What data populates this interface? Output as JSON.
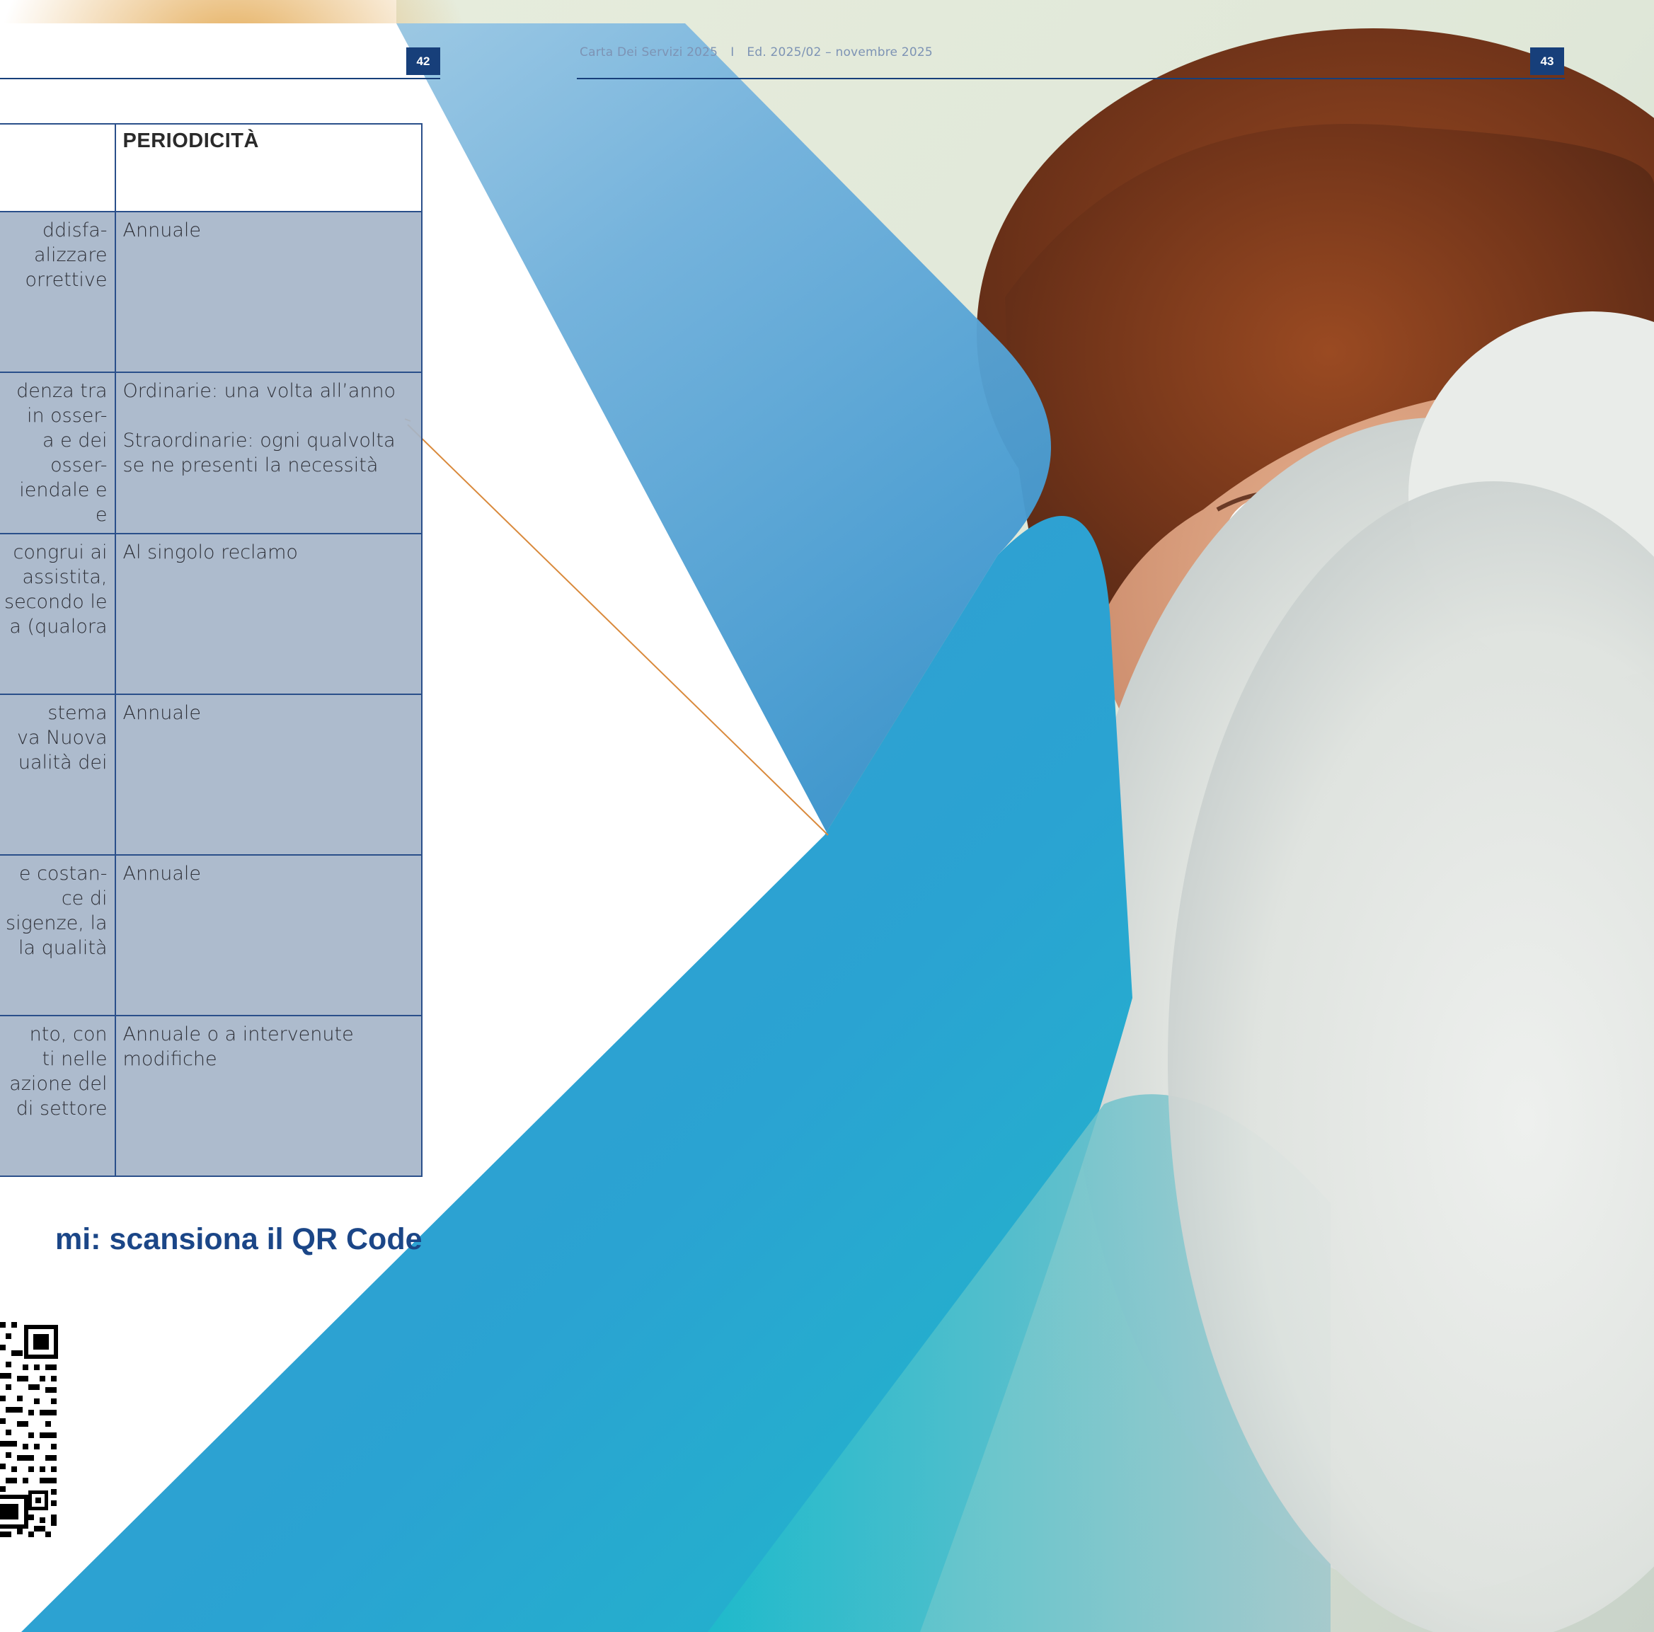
{
  "header": {
    "left_page_number": "42",
    "right_page_number": "43",
    "running_title": "Carta Dei Servizi 2025",
    "separator": "I",
    "edition": "Ed. 2025/02 – novembre 2025"
  },
  "table": {
    "column_header": "PERIODICITÀ",
    "rows": [
      {
        "fragments": [
          "ddisfa-",
          "alizzare",
          "orrettive"
        ],
        "periodicity": [
          "Annuale"
        ]
      },
      {
        "fragments": [
          "denza tra",
          "in osser-",
          "a e dei",
          "osser-",
          "iendale e",
          "e"
        ],
        "periodicity": [
          "Ordinarie: una volta all’anno",
          "Straordinarie: ogni qualvolta se ne presenti la necessità"
        ]
      },
      {
        "fragments": [
          "congrui ai",
          "assistita,",
          "secondo le",
          "a (qualora"
        ],
        "periodicity": [
          "Al singolo reclamo"
        ]
      },
      {
        "fragments": [
          "stema",
          "va Nuova",
          "ualità dei"
        ],
        "periodicity": [
          "Annuale"
        ]
      },
      {
        "fragments": [
          "e costan-",
          "ce di",
          "sigenze, la",
          "la qualità"
        ],
        "periodicity": [
          "Annuale"
        ]
      },
      {
        "fragments": [
          "nto, con",
          "ti nelle",
          "azione del",
          "di settore"
        ],
        "periodicity": [
          "Annuale o a intervenute modifiche"
        ]
      }
    ]
  },
  "qr_section": {
    "title": "mi: scansiona il QR Code"
  },
  "colors": {
    "brand_navy": "#173f7a",
    "table_fill": "#a6b5c9",
    "title_blue": "#1b4687",
    "chevron_blue": "#3b95cf"
  },
  "icons": [
    "qr-code-icon"
  ]
}
